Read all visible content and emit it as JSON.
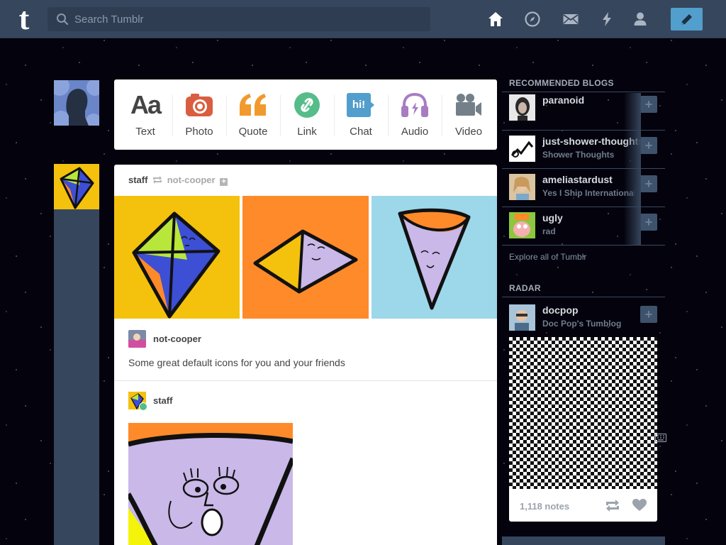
{
  "topbar": {
    "logo": "t",
    "search_placeholder": "Search Tumblr",
    "nav": [
      "home-icon",
      "explore-icon",
      "inbox-icon",
      "activity-icon",
      "account-icon"
    ],
    "compose_icon": "pencil-icon"
  },
  "post_types": [
    {
      "label": "Text",
      "glyph": "Aa",
      "icon": "text-icon",
      "color": "#444444"
    },
    {
      "label": "Photo",
      "icon": "camera-icon",
      "color": "#d95e40"
    },
    {
      "label": "Quote",
      "icon": "quote-icon",
      "color": "#f2992e"
    },
    {
      "label": "Link",
      "icon": "link-icon",
      "color": "#56bc8a"
    },
    {
      "label": "Chat",
      "glyph": "hi!",
      "icon": "chat-icon",
      "color": "#529ecc"
    },
    {
      "label": "Audio",
      "icon": "headphones-icon",
      "color": "#a77dc2"
    },
    {
      "label": "Video",
      "icon": "video-camera-icon",
      "color": "#748089"
    }
  ],
  "post": {
    "author": "staff",
    "reblogged_from": "not-cooper",
    "trail": [
      {
        "name": "not-cooper",
        "body": "Some great default icons for you and your friends"
      },
      {
        "name": "staff"
      }
    ]
  },
  "sidebar": {
    "recommended_title": "RECOMMENDED BLOGS",
    "recommended": [
      {
        "name": "paranoid",
        "subtitle": ""
      },
      {
        "name": "just-shower-thoughts",
        "subtitle": "Shower Thoughts"
      },
      {
        "name": "ameliastardust",
        "subtitle": "Yes I Ship International"
      },
      {
        "name": "ugly",
        "subtitle": "rad"
      }
    ],
    "explore_link": "Explore all of Tumblr",
    "radar_title": "RADAR",
    "radar": {
      "name": "docpop",
      "subtitle": "Doc Pop's Tumblog",
      "notes": "1,118 notes"
    }
  },
  "colors": {
    "header": "#36465d",
    "accent": "#529ecc",
    "background": "#04030d"
  }
}
